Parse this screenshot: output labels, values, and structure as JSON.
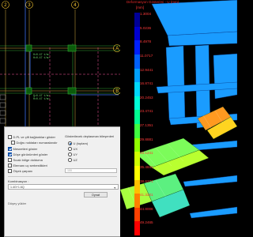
{
  "cad": {
    "axes_top": [
      "2",
      "3",
      "4"
    ],
    "axes_right": [
      "A",
      "B"
    ],
    "notes": [
      "0=0.47 t/m²",
      "H=0.47 t/m²",
      "Q=0.47 t/m²",
      "H=0.47 t/m²"
    ]
  },
  "dialog": {
    "options": [
      {
        "label": "D.PL ve çift bağlantıları göster",
        "checked": false
      },
      {
        "label": "Doğru noktaları numaralandır",
        "checked": false
      },
      {
        "label": "Mesnetleri göster",
        "checked": true
      },
      {
        "label": "Döşe görünümleri göster",
        "checked": true
      },
      {
        "label": "Sıcak bölge dolduma",
        "checked": false
      },
      {
        "label": "Elemanı uç serbestlikleri",
        "checked": false
      },
      {
        "label": "Ölçek çarpanı",
        "checked": false
      }
    ],
    "scale_value": "100",
    "display_group_title": "Gösterilecek deplasman bileşenleri",
    "display_options": [
      {
        "label": "U (toplam)",
        "selected": true
      },
      {
        "label": "UX",
        "selected": false
      },
      {
        "label": "UY",
        "selected": false
      },
      {
        "label": "UZ",
        "selected": false
      }
    ],
    "combo_label": "Kombinasyon :",
    "combo_value": "1.4G+1.6Q",
    "action_label": "Oynat",
    "footer_label": "Düşey yükler"
  },
  "view3d": {
    "title": "Deformasyon Gösterimi - U (mm)",
    "unit": "[mm]",
    "legend_values": [
      "1.3004",
      "5.0236",
      "8.4978",
      "11.0717",
      "12.9441",
      "16.8741",
      "20.2453",
      "23.4741",
      "27.1351",
      "29.8881",
      "33.1241",
      "35.4841",
      "38.6271",
      "41.3201",
      "44.8008",
      "49.2465"
    ],
    "legend_colors": [
      "#000096",
      "#0000d0",
      "#0020ff",
      "#0060ff",
      "#00a0ff",
      "#00d8ff",
      "#00ffd8",
      "#00ff90",
      "#40ff40",
      "#90ff00",
      "#d0ff00",
      "#ffff00",
      "#ffc000",
      "#ff8000",
      "#ff4000",
      "#ff0000"
    ]
  }
}
